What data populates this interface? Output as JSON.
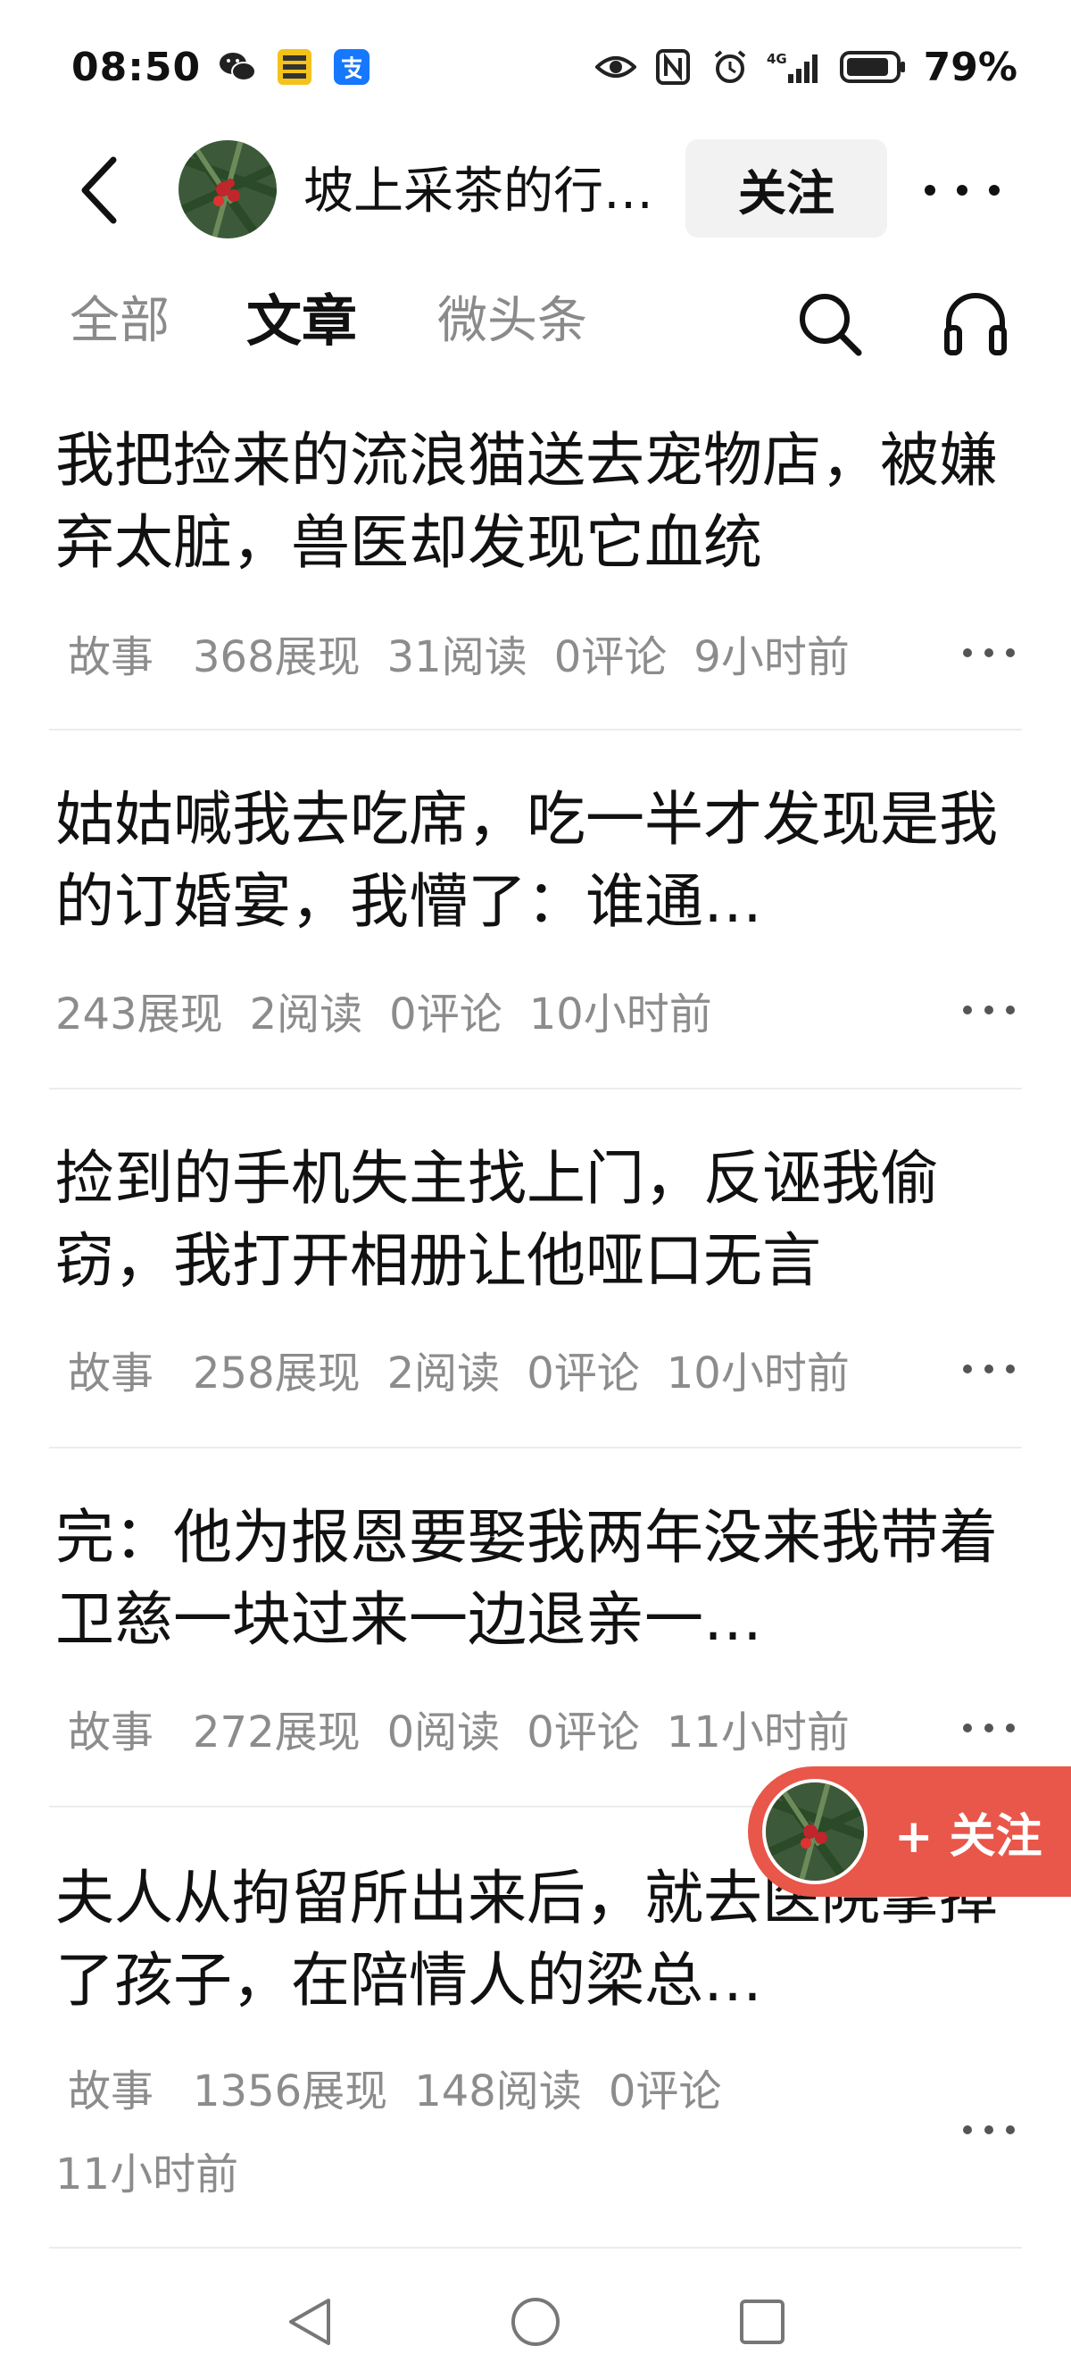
{
  "status_bar": {
    "time": "08:50",
    "battery": "79%",
    "network": "4G",
    "left_icons": [
      "wechat-icon",
      "app-icon",
      "alipay-icon"
    ],
    "right_icons": [
      "eye-icon",
      "nfc-icon",
      "alarm-icon",
      "signal-icon",
      "battery-icon"
    ]
  },
  "header": {
    "author_name": "坡上采茶的行…",
    "follow_label": "关注"
  },
  "tabs": {
    "items": [
      "全部",
      "文章",
      "微头条"
    ],
    "active": "文章"
  },
  "articles": [
    {
      "title": "我把捡来的流浪猫送去宠物店，被嫌弃太脏，兽医却发现它血统",
      "tag": "故事",
      "impressions": "368展现",
      "reads": "31阅读",
      "comments": "0评论",
      "time": "9小时前"
    },
    {
      "title": "姑姑喊我去吃席，吃一半才发现是我的订婚宴，我懵了：谁通…",
      "tag": "",
      "impressions": "243展现",
      "reads": "2阅读",
      "comments": "0评论",
      "time": "10小时前"
    },
    {
      "title": "捡到的手机失主找上门，反诬我偷窃，我打开相册让他哑口无言",
      "tag": "故事",
      "impressions": "258展现",
      "reads": "2阅读",
      "comments": "0评论",
      "time": "10小时前"
    },
    {
      "title": "完：他为报恩要娶我两年没来我带着卫慈一块过来一边退亲一…",
      "tag": "故事",
      "impressions": "272展现",
      "reads": "0阅读",
      "comments": "0评论",
      "time": "11小时前"
    },
    {
      "title": "夫人从拘留所出来后，就去医院拿掉了孩子，在陪情人的梁总…",
      "tag": "故事",
      "impressions": "1356展现",
      "reads": "148阅读",
      "comments": "0评论",
      "time": "11小时前"
    }
  ],
  "float_follow": {
    "label": "+ 关注"
  },
  "colors": {
    "accent_red": "#e8574a",
    "meta_gray": "#8c8c8c",
    "tab_inactive": "#8a8a8a"
  }
}
